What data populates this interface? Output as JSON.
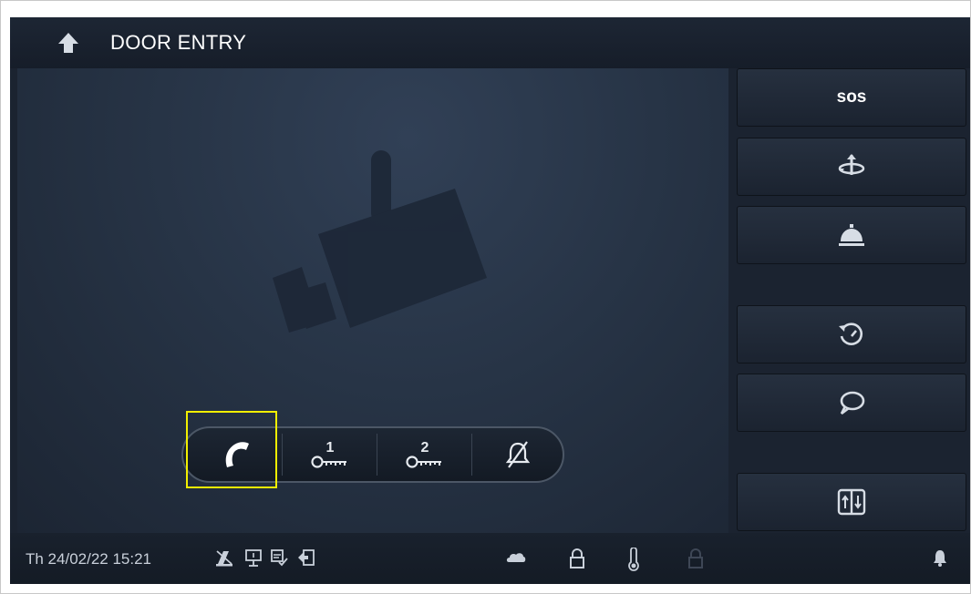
{
  "header": {
    "title": "DOOR ENTRY",
    "back_icon": "back-arrow-icon"
  },
  "video": {
    "placeholder_icon": "security-camera-icon"
  },
  "call_bar": {
    "buttons": [
      {
        "name": "answer-call-button",
        "icon": "handset-icon"
      },
      {
        "name": "unlock-door-1-button",
        "icon": "key-1-icon",
        "label": "1"
      },
      {
        "name": "unlock-door-2-button",
        "icon": "key-2-icon",
        "label": "2"
      },
      {
        "name": "mute-ringtone-button",
        "icon": "bell-mute-icon"
      }
    ],
    "highlighted": "answer-call-button",
    "highlight_color": "#f2ef00"
  },
  "side_panel": {
    "sos_label": "sos",
    "buttons": [
      "sos-button",
      "switch-camera-button",
      "concierge-button",
      "history-button",
      "message-button",
      "elevator-button"
    ]
  },
  "status_bar": {
    "datetime": "Th 24/02/22  15:21",
    "left_icons": [
      "no-disturb-icon",
      "intercom-icon",
      "message-checked-icon",
      "logout-icon"
    ],
    "center_icons": [
      "cloud-icon",
      "lock-icon",
      "thermometer-icon",
      "lock-disabled-icon"
    ],
    "right_icons": [
      "bell-icon"
    ]
  },
  "colors": {
    "background": "#1b2330",
    "icon": "#d7dde5",
    "text": "#ffffff"
  }
}
